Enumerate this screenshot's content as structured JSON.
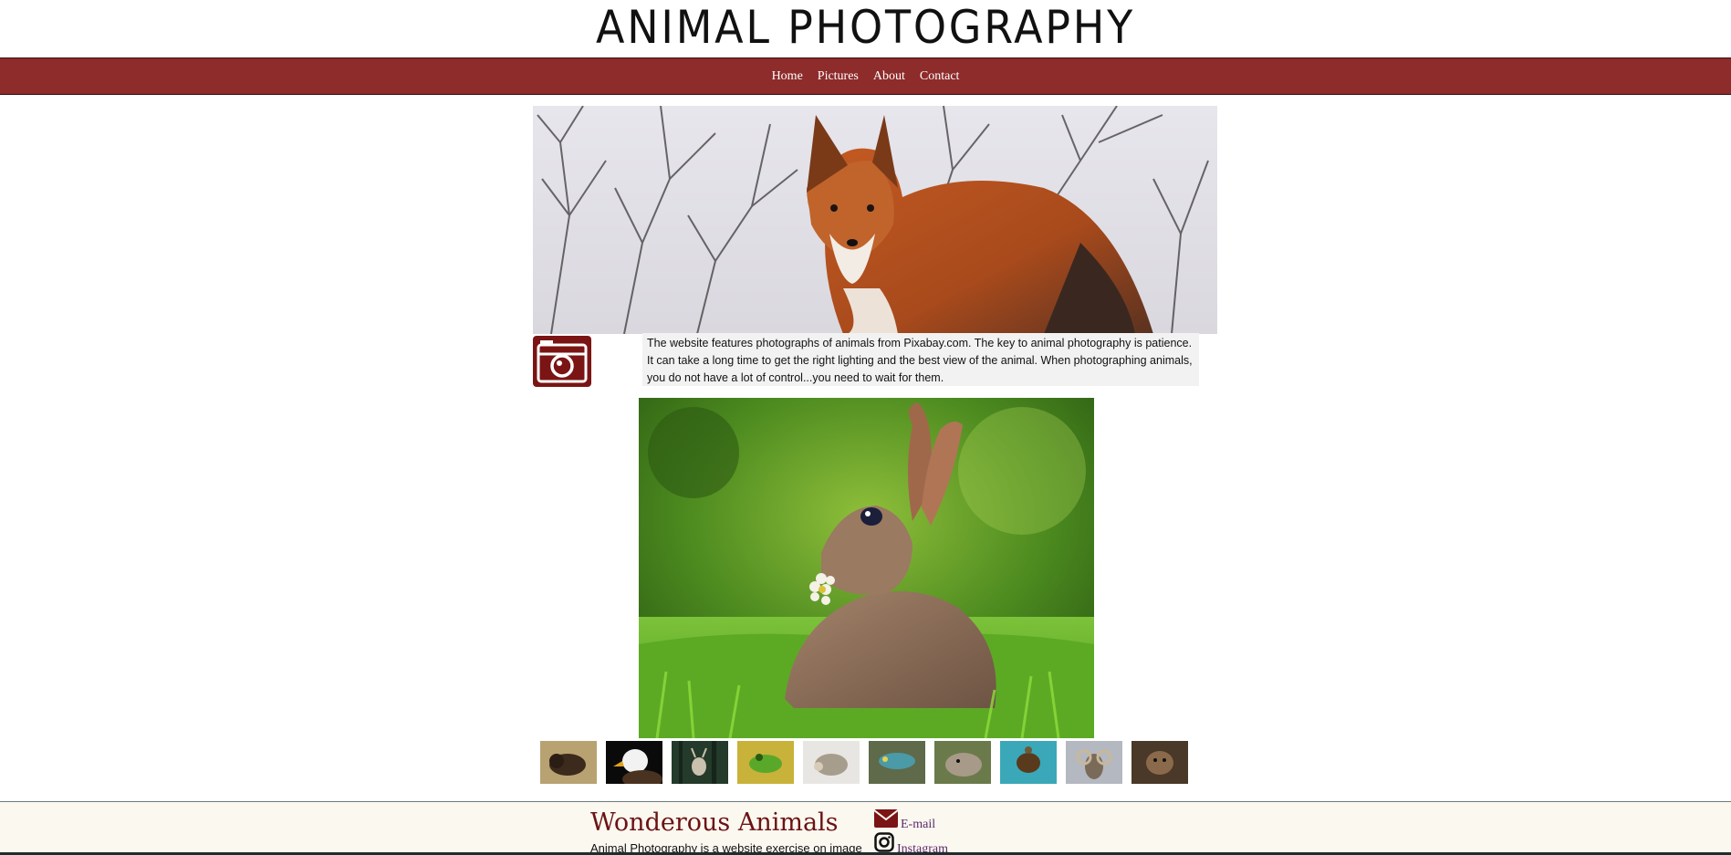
{
  "site": {
    "title": "ANIMAL PHOTOGRAPHY"
  },
  "nav": {
    "items": [
      {
        "label": "Home"
      },
      {
        "label": "Pictures"
      },
      {
        "label": "About"
      },
      {
        "label": "Contact"
      }
    ]
  },
  "intro": {
    "icon": "camera-icon",
    "text": "The website features photographs of animals from Pixabay.com. The key to animal photography is patience. It can take a long time to get the right lighting and the best view of the animal. When photographing animals, you do not have a lot of control...you need to wait for them."
  },
  "hero": {
    "subject": "red fox in snowy woods"
  },
  "feature": {
    "subject": "rabbit with flower in grass"
  },
  "thumbnails": [
    {
      "subject": "bison"
    },
    {
      "subject": "bald eagle"
    },
    {
      "subject": "deer"
    },
    {
      "subject": "frog"
    },
    {
      "subject": "hedgehog"
    },
    {
      "subject": "lizard"
    },
    {
      "subject": "seal"
    },
    {
      "subject": "turtle"
    },
    {
      "subject": "ram"
    },
    {
      "subject": "otter"
    }
  ],
  "footer": {
    "title": "Wonderous Animals",
    "text": "Animal Photography is a website exercise on image",
    "links": [
      {
        "label": "E-mail",
        "icon": "envelope-icon"
      },
      {
        "label": "Instagram",
        "icon": "instagram-icon"
      }
    ]
  },
  "colors": {
    "brand": "#8e2b2b",
    "icon": "#7b1414",
    "footer_bg": "#fbf8f0",
    "link": "#5a2a6b"
  }
}
